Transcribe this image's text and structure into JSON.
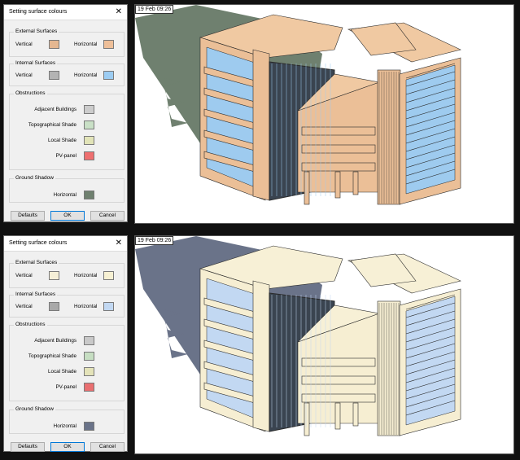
{
  "panels": [
    {
      "dialog": {
        "title": "Setting surface colours",
        "close_symbol": "✕",
        "external": {
          "title": "External Surfaces",
          "vertical_label": "Vertical",
          "horizontal_label": "Horizontal",
          "vertical_color": "#e4b791",
          "horizontal_color": "#eebf99"
        },
        "internal": {
          "title": "Internal Surfaces",
          "vertical_label": "Vertical",
          "horizontal_label": "Horizontal",
          "vertical_color": "#b3b3b3",
          "horizontal_color": "#9cccf2"
        },
        "obstructions": {
          "title": "Obstructions",
          "items": [
            {
              "label": "Adjacent Buildings",
              "color": "#cccccc"
            },
            {
              "label": "Topographical Shade",
              "color": "#c9e0c6"
            },
            {
              "label": "Local Shade",
              "color": "#e2e4b8"
            },
            {
              "label": "PV-panel",
              "color": "#ee6f6f"
            }
          ]
        },
        "ground": {
          "title": "Ground Shadow",
          "horizontal_label": "Horizontal",
          "color": "#6f806f"
        },
        "buttons": {
          "defaults": "Defaults",
          "ok": "OK",
          "cancel": "Cancel"
        }
      },
      "render": {
        "timestamp": "19 Feb 09:26",
        "shadow_color": "#6f806f",
        "facade_color": "#ebbf97",
        "roof_color": "#f0c9a2",
        "glass_color": "#9ecbef",
        "frame_color": "#2a2a2a"
      }
    },
    {
      "dialog": {
        "title": "Setting surface colours",
        "close_symbol": "✕",
        "external": {
          "title": "External Surfaces",
          "vertical_label": "Vertical",
          "horizontal_label": "Horizontal",
          "vertical_color": "#f5efd7",
          "horizontal_color": "#f7f1d3"
        },
        "internal": {
          "title": "Internal Surfaces",
          "vertical_label": "Vertical",
          "horizontal_label": "Horizontal",
          "vertical_color": "#a9a9a9",
          "horizontal_color": "#c2d8f2"
        },
        "obstructions": {
          "title": "Obstructions",
          "items": [
            {
              "label": "Adjacent Buildings",
              "color": "#c9c9c9"
            },
            {
              "label": "Topographical Shade",
              "color": "#c6dec2"
            },
            {
              "label": "Local Shade",
              "color": "#e4e3b9"
            },
            {
              "label": "PV-panel",
              "color": "#e96f70"
            }
          ]
        },
        "ground": {
          "title": "Ground Shadow",
          "horizontal_label": "Horizontal",
          "color": "#6a7389"
        },
        "buttons": {
          "defaults": "Defaults",
          "ok": "OK",
          "cancel": "Cancel"
        }
      },
      "render": {
        "timestamp": "19 Feb 09:26",
        "shadow_color": "#6a7389",
        "facade_color": "#f6eed2",
        "roof_color": "#f7f0d6",
        "glass_color": "#c2d8f2",
        "frame_color": "#2a2a2a"
      }
    }
  ]
}
